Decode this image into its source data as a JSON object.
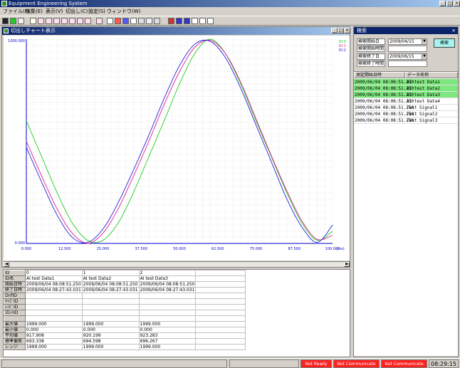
{
  "app": {
    "title": "Equipment Engineering System"
  },
  "menu": {
    "items": [
      "ファイル(F)",
      "編集(E)",
      "表示(V)",
      "切出し(C)",
      "設定(S)",
      "ウィンドウ(W)"
    ]
  },
  "window_buttons": {
    "minimize": "_",
    "maximize": "□",
    "close": "×"
  },
  "chart_window": {
    "title": "切出しチャート表示"
  },
  "chart_data": {
    "type": "line",
    "x_ticks": [
      "0.000",
      "12.500",
      "25.000",
      "37.500",
      "50.000",
      "62.500",
      "75.000",
      "87.500",
      "100.000"
    ],
    "x_unit": "(ms)",
    "xlim": [
      0,
      100
    ],
    "y_top_label": "1000.000",
    "y_bottom_label": "0.000",
    "ylim": [
      0,
      1000
    ],
    "grid": true,
    "legend_position": "top-right",
    "colors": {
      "ID:0": "#22cc22",
      "ID:1": "#e0208a",
      "ID:2": "#2020dd"
    },
    "series": [
      {
        "name": "ID:0",
        "x": [
          0,
          5,
          10,
          15,
          20,
          25,
          30,
          35,
          40,
          45,
          50,
          55,
          60,
          65,
          70,
          75,
          80,
          85,
          90,
          95,
          100
        ],
        "values": [
          600,
          425,
          250,
          100,
          15,
          15,
          100,
          250,
          425,
          600,
          780,
          930,
          1000,
          930,
          780,
          600,
          425,
          250,
          100,
          15,
          60
        ]
      },
      {
        "name": "ID:1",
        "x": [
          0,
          5,
          10,
          15,
          20,
          25,
          30,
          35,
          40,
          45,
          50,
          55,
          60,
          65,
          70,
          75,
          80,
          85,
          90,
          95,
          100
        ],
        "values": [
          500,
          330,
          170,
          50,
          0,
          50,
          170,
          330,
          500,
          680,
          840,
          960,
          995,
          930,
          790,
          610,
          430,
          260,
          110,
          20,
          40
        ]
      },
      {
        "name": "ID:2",
        "x": [
          0,
          5,
          10,
          15,
          20,
          25,
          30,
          35,
          40,
          45,
          50,
          55,
          60,
          65,
          70,
          75,
          80,
          85,
          90,
          95,
          100
        ],
        "values": [
          470,
          300,
          140,
          30,
          5,
          70,
          200,
          360,
          530,
          710,
          870,
          975,
          990,
          910,
          760,
          580,
          400,
          220,
          80,
          5,
          90
        ]
      }
    ]
  },
  "data_table": {
    "row_labels": [
      "ID",
      "ID名",
      "開始日時",
      "終了日時",
      "DnfID",
      "ｷｬｽﾞID",
      "ﾚｼﾋﾟID",
      "ｽﾛｯﾄID",
      "",
      "最大値",
      "最小値",
      "平均値",
      "標準偏差",
      "レンジ"
    ],
    "columns": [
      {
        "values": [
          "0",
          "AI test Data1",
          "2009/06/04 08:08:51.250",
          "2009/06/04 08:27:43.031",
          "",
          "",
          "",
          "",
          "",
          "1999.000",
          "0.000",
          "917.908",
          "693.338",
          "1999.000"
        ]
      },
      {
        "values": [
          "1",
          "AI test Data2",
          "2009/06/04 08:08:51.250",
          "2009/06/04 08:27:43.031",
          "",
          "",
          "",
          "",
          "",
          "1999.000",
          "0.000",
          "920.199",
          "694.598",
          "1999.000"
        ]
      },
      {
        "values": [
          "2",
          "AI test Data3",
          "2009/06/04 08:08:51.250",
          "2009/06/04 08:27:43.031",
          "",
          "",
          "",
          "",
          "",
          "1999.000",
          "0.000",
          "923.283",
          "696.267",
          "1999.000"
        ]
      }
    ]
  },
  "search": {
    "title": "検索",
    "start_date_label": "検索開始日",
    "start_date_value": "2009/04/15",
    "start_time_label": "検索開始時間",
    "end_date_label": "検索終了日",
    "end_date_value": "2009/06/15",
    "end_time_label": "検索終了時間",
    "button_label": "検索",
    "list_headers": [
      "測定開始日時",
      "データ名称"
    ],
    "rows": [
      {
        "datetime": "2009/06/04 08:08:51.250",
        "name": "AI test Data1",
        "highlight": true
      },
      {
        "datetime": "2009/06/04 08:08:51.250",
        "name": "AI test Data2",
        "highlight": true
      },
      {
        "datetime": "2009/06/04 08:08:51.250",
        "name": "AI test Data3",
        "highlight": true
      },
      {
        "datetime": "2009/06/04 08:08:51.250",
        "name": "AI test Data4",
        "highlight": false
      },
      {
        "datetime": "2009/06/04 08:08:51.250",
        "name": "Test Signal1",
        "highlight": false
      },
      {
        "datetime": "2009/06/04 08:08:51.250",
        "name": "Test Signal2",
        "highlight": false
      },
      {
        "datetime": "2009/06/04 08:08:51.250",
        "name": "Test Signal3",
        "highlight": false
      }
    ],
    "highlight_color": "#7ee87e"
  },
  "status": {
    "cells": [
      "Not Ready",
      "Not Communicate",
      "Not Communicate"
    ],
    "time": "08:29:15",
    "alert_color": "#ff2020"
  }
}
